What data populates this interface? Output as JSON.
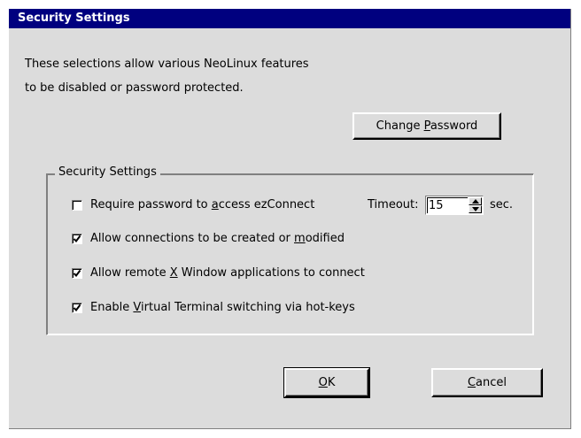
{
  "window": {
    "title": "Security Settings"
  },
  "intro": {
    "line1": "These selections allow various NeoLinux features",
    "line2": "to be disabled or password protected."
  },
  "change_password": {
    "pre": "Change ",
    "mnemonic": "P",
    "post": "assword"
  },
  "group": {
    "title": "Security Settings"
  },
  "options": [
    {
      "pre": "Require password to ",
      "mnemonic": "a",
      "post": "ccess ezConnect",
      "checked": false
    },
    {
      "pre": "Allow connections to be created or ",
      "mnemonic": "m",
      "post": "odified",
      "checked": true
    },
    {
      "pre": "Allow remote ",
      "mnemonic": "X",
      "post": " Window applications to connect",
      "checked": true
    },
    {
      "pre": "Enable ",
      "mnemonic": "V",
      "post": "irtual Terminal switching via hot-keys",
      "checked": true
    }
  ],
  "timeout": {
    "label": "Timeout:",
    "value": "15",
    "unit": "sec."
  },
  "ok": {
    "mnemonic": "O",
    "post": "K"
  },
  "cancel": {
    "mnemonic": "C",
    "post": "ancel"
  }
}
